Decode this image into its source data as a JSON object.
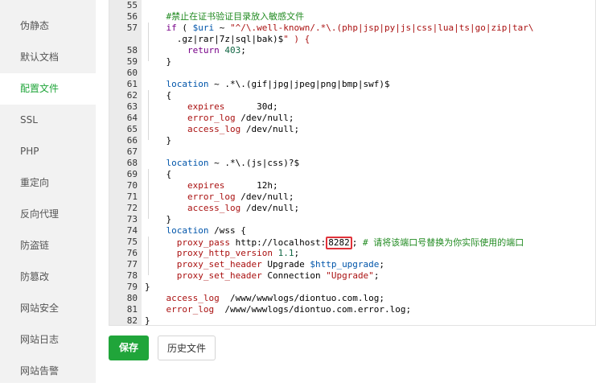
{
  "sidebar": {
    "items": [
      {
        "label": "伪静态"
      },
      {
        "label": "默认文档"
      },
      {
        "label": "配置文件",
        "active": true
      },
      {
        "label": "SSL"
      },
      {
        "label": "PHP"
      },
      {
        "label": "重定向"
      },
      {
        "label": "反向代理"
      },
      {
        "label": "防盗链"
      },
      {
        "label": "防篡改"
      },
      {
        "label": "网站安全"
      },
      {
        "label": "网站日志"
      },
      {
        "label": "网站告警"
      }
    ]
  },
  "editor": {
    "lines": [
      {
        "n": "55",
        "code": ""
      },
      {
        "n": "56",
        "code": "    #禁止在证书验证目录放入敏感文件"
      },
      {
        "n": "57",
        "code": "    if ( $uri ~ \"^/\\.well-known/.*\\.(php|jsp|py|js|css|lua|ts|go|zip|tar\\"
      },
      {
        "n": "",
        "code": "      .gz|rar|7z|sql|bak)$\" ) {"
      },
      {
        "n": "58",
        "code": "        return 403;"
      },
      {
        "n": "59",
        "code": "    }"
      },
      {
        "n": "60",
        "code": ""
      },
      {
        "n": "61",
        "code": "    location ~ .*\\.(gif|jpg|jpeg|png|bmp|swf)$"
      },
      {
        "n": "62",
        "code": "    {"
      },
      {
        "n": "63",
        "code": "        expires      30d;"
      },
      {
        "n": "64",
        "code": "        error_log /dev/null;"
      },
      {
        "n": "65",
        "code": "        access_log /dev/null;"
      },
      {
        "n": "66",
        "code": "    }"
      },
      {
        "n": "67",
        "code": ""
      },
      {
        "n": "68",
        "code": "    location ~ .*\\.(js|css)?$"
      },
      {
        "n": "69",
        "code": "    {"
      },
      {
        "n": "70",
        "code": "        expires      12h;"
      },
      {
        "n": "71",
        "code": "        error_log /dev/null;"
      },
      {
        "n": "72",
        "code": "        access_log /dev/null;"
      },
      {
        "n": "73",
        "code": "    }"
      },
      {
        "n": "74",
        "code": "    location /wss {"
      },
      {
        "n": "75",
        "code": "      proxy_pass http://localhost:8282; # 请将该端口号替换为你实际使用的端口"
      },
      {
        "n": "76",
        "code": "      proxy_http_version 1.1;"
      },
      {
        "n": "77",
        "code": "      proxy_set_header Upgrade $http_upgrade;"
      },
      {
        "n": "78",
        "code": "      proxy_set_header Connection \"Upgrade\";"
      },
      {
        "n": "79",
        "code": "}"
      },
      {
        "n": "80",
        "code": "    access_log  /www/wwwlogs/diontuo.com.log;"
      },
      {
        "n": "81",
        "code": "    error_log  /www/wwwlogs/diontuo.com.error.log;"
      },
      {
        "n": "82",
        "code": "}"
      }
    ],
    "highlight": {
      "line": "75",
      "text": "8282"
    }
  },
  "buttons": {
    "save": "保存",
    "history": "历史文件"
  },
  "colors": {
    "accent": "#20a53a",
    "highlight_border": "#e0323a"
  }
}
